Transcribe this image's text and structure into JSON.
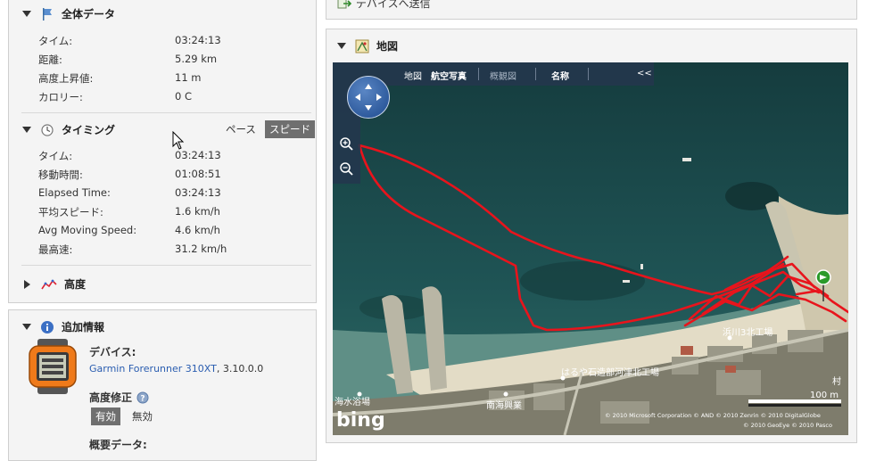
{
  "overall": {
    "title": "全体データ",
    "rows": [
      {
        "label": "タイム:",
        "value": "03:24:13"
      },
      {
        "label": "距離:",
        "value": "5.29 km"
      },
      {
        "label": "高度上昇値:",
        "value": "11 m"
      },
      {
        "label": "カロリー:",
        "value": "0 C"
      }
    ]
  },
  "timing": {
    "title": "タイミング",
    "pace_label": "ペース",
    "speed_label": "スピード",
    "rows": [
      {
        "label": "タイム:",
        "value": "03:24:13"
      },
      {
        "label": "移動時間:",
        "value": "01:08:51"
      },
      {
        "label": "Elapsed Time:",
        "value": "03:24:13"
      },
      {
        "label": "平均スピード:",
        "value": "1.6 km/h"
      },
      {
        "label": "Avg Moving Speed:",
        "value": "4.6 km/h"
      },
      {
        "label": "最高速:",
        "value": "31.2 km/h"
      }
    ]
  },
  "elevation": {
    "title": "高度"
  },
  "extra": {
    "title": "追加情報",
    "device_label": "デバイス:",
    "device_name": "Garmin Forerunner 310XT",
    "device_version": ", 3.10.0.0",
    "elev_corr_label": "高度修正",
    "enabled_label": "有効",
    "disabled_label": "無効",
    "summary_label": "概要データ:"
  },
  "send": {
    "label": "デバイスへ送信"
  },
  "map": {
    "title": "地図",
    "tabs": {
      "road": "地図",
      "aerial": "航空写真",
      "birdseye": "概観図",
      "labels": "名称",
      "collapse": "<<"
    },
    "places": {
      "beach": "海水浴場",
      "nankai": "南海興業",
      "factory1": "はるや石造部河津北工場",
      "factory2": "浜川3北工場",
      "edge": "村"
    },
    "scale": "100 m",
    "brand": "bing",
    "copyright1": "© 2010 Microsoft Corporation  © AND  © 2010 Zenrin  © 2010 DigitalGlobe",
    "copyright2": "© 2010 GeoEye  © 2010 Pasco"
  },
  "colors": {
    "track": "#e8141c",
    "link": "#2a5db0",
    "water": "#1e4e50"
  }
}
